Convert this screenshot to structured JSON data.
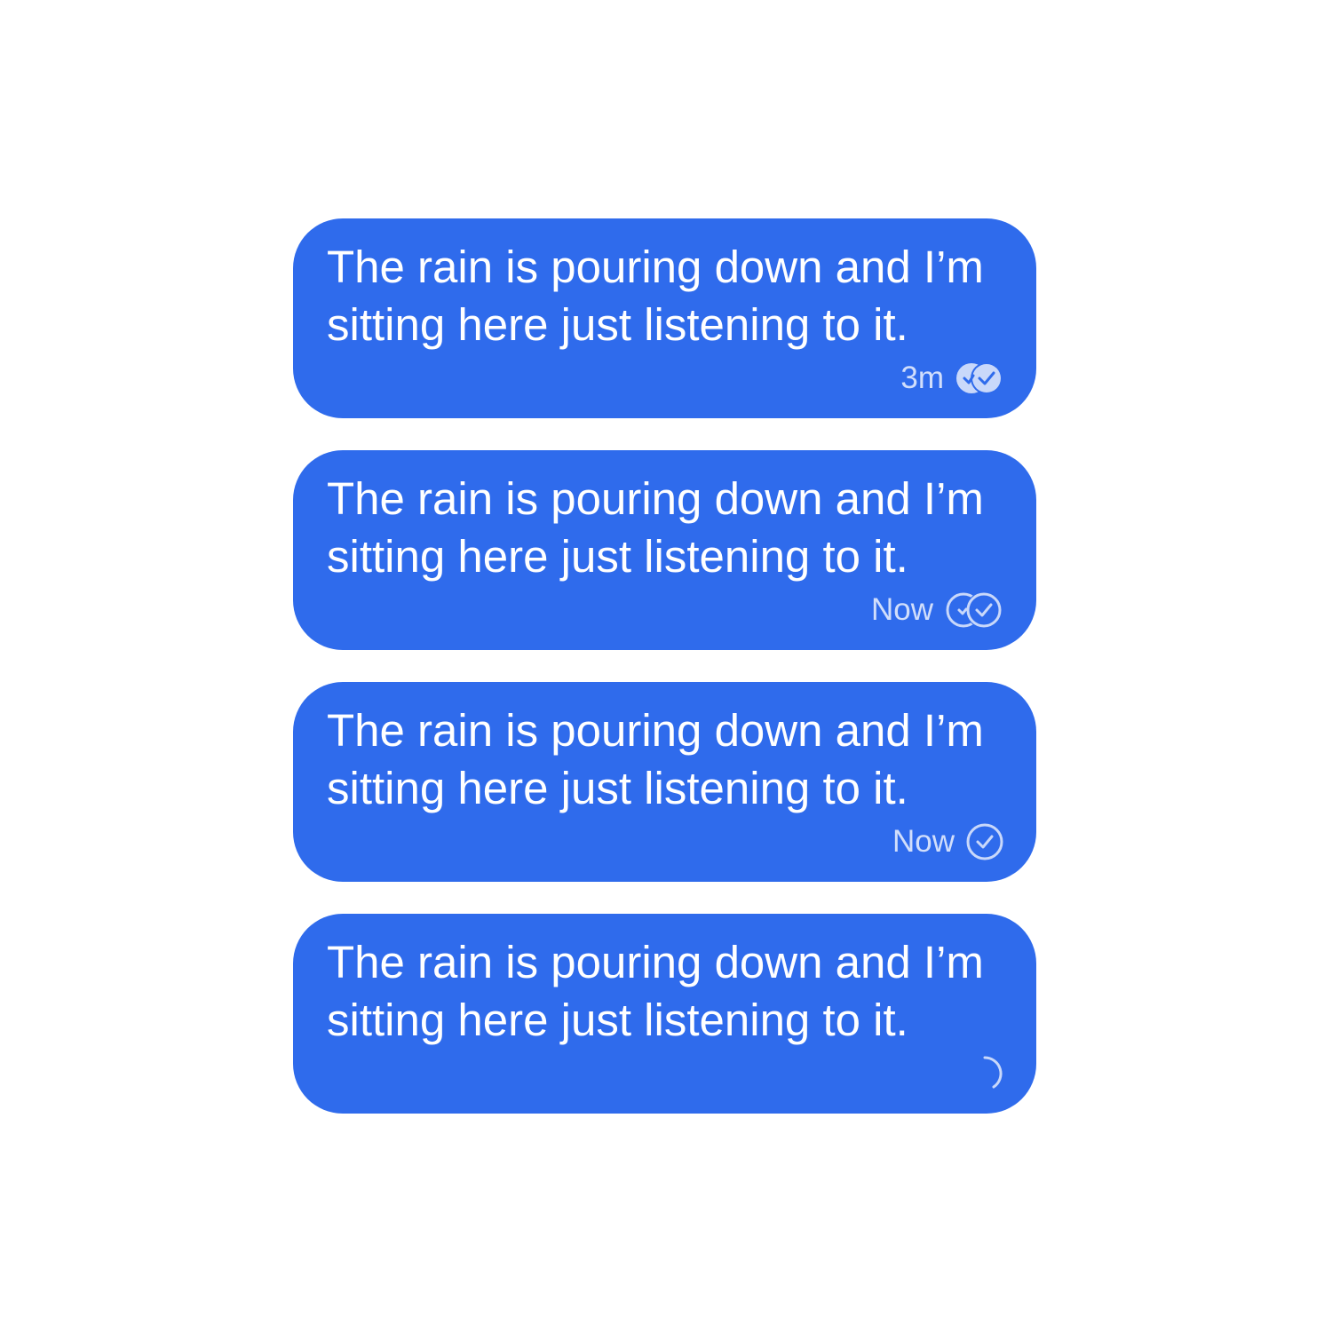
{
  "messages": [
    {
      "text": "The rain is pouring down and I’m sitting here just listening to it.",
      "time": "3m",
      "status": "read",
      "status_icon": "double-check-filled-icon"
    },
    {
      "text": "The rain is pouring down and I’m sitting here just listening to it.",
      "time": "Now",
      "status": "delivered",
      "status_icon": "double-check-outline-icon"
    },
    {
      "text": "The rain is pouring down and I’m sitting here just listening to it.",
      "time": "Now",
      "status": "sent",
      "status_icon": "single-check-outline-icon"
    },
    {
      "text": "The rain is pouring down and I’m sitting here just listening to it.",
      "time": "",
      "status": "sending",
      "status_icon": "loading-spinner-icon"
    }
  ],
  "colors": {
    "bubble": "#2F6BEC",
    "text": "#FFFFFF",
    "meta": "#C9D8FA"
  }
}
